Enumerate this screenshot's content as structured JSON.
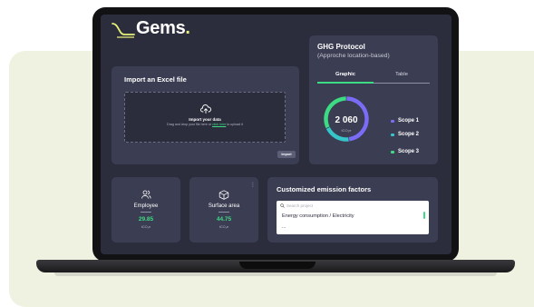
{
  "brand": {
    "name": "Gems",
    "dot": ".",
    "accent_color": "#3ddc84",
    "logo_color": "#e8f07a"
  },
  "import": {
    "title": "Import an Excel file",
    "drop_title": "Import your data",
    "drop_prefix": "Drag and drop your file here or ",
    "drop_link": "click here",
    "drop_suffix": " to upload it",
    "button_label": "Import",
    "icon": "cloud-upload-icon"
  },
  "ghg": {
    "title": "GHG Protocol",
    "subtitle": "(Approche location-based)",
    "tabs": [
      {
        "label": "Graphic",
        "active": true
      },
      {
        "label": "Table",
        "active": false
      }
    ],
    "total_value": "2 060",
    "total_unit": "tCO₂e",
    "legend": [
      {
        "label": "Scope 1",
        "color": "#7b6cf6"
      },
      {
        "label": "Scope 2",
        "color": "#36c6c9"
      },
      {
        "label": "Scope 3",
        "color": "#3ddc84"
      }
    ]
  },
  "chart_data": {
    "type": "pie",
    "categories": [
      "Scope 1",
      "Scope 2",
      "Scope 3"
    ],
    "values": [
      48,
      20,
      32
    ],
    "total": "2 060",
    "unit": "tCO₂e"
  },
  "stats": [
    {
      "label": "Employee",
      "value": "29.85",
      "unit": "tCO₂e",
      "icon": "users-icon"
    },
    {
      "label": "Surface area",
      "value": "44.75",
      "unit": "tCO₂e",
      "icon": "cube-icon"
    }
  ],
  "factors": {
    "title": "Customized emission factors",
    "search_placeholder": "Search project",
    "options": [
      "Energy consumption / Electricity",
      "..."
    ]
  }
}
